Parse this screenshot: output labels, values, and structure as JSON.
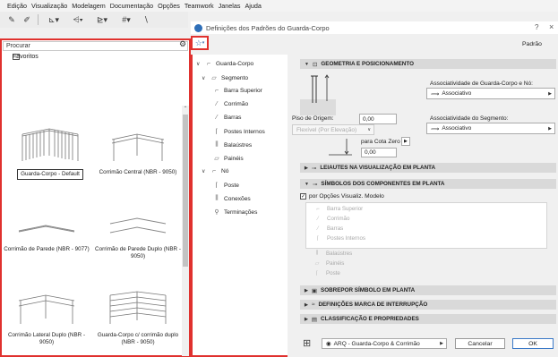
{
  "menubar": [
    "Edição",
    "Visualização",
    "Modelagem",
    "Documentação",
    "Opções",
    "Teamwork",
    "Janelas",
    "Ajuda"
  ],
  "library": {
    "search_placeholder": "Procurar",
    "favorites_label": "Favoritos",
    "items": [
      {
        "caption": "Guarda-Corpo - Default",
        "selected": true
      },
      {
        "caption": "Corrimão Central (NBR - 9050)",
        "selected": false
      },
      {
        "caption": "Corrimão de Parede (NBR - 9077)",
        "selected": false
      },
      {
        "caption": "Corrimão de Parede Duplo (NBR - 9050)",
        "selected": false
      },
      {
        "caption": "Corrimão Lateral Duplo (NBR - 9050)",
        "selected": false
      },
      {
        "caption": "Guarda-Corpo c/ corrimão duplo (NBR - 9050)",
        "selected": false
      }
    ]
  },
  "dialog": {
    "title": "Definições dos Padrões do Guarda-Corpo",
    "help": "?",
    "close": "×",
    "preset_label": "Padrão"
  },
  "tree": [
    {
      "label": "Guarda-Corpo",
      "level": 0,
      "chev": "∨",
      "icon": "⌐"
    },
    {
      "label": "Segmento",
      "level": 1,
      "chev": "∨",
      "icon": "▱"
    },
    {
      "label": "Barra Superior",
      "level": 2,
      "chev": "",
      "icon": "⌐"
    },
    {
      "label": "Corrimão",
      "level": 2,
      "chev": "",
      "icon": "⁄"
    },
    {
      "label": "Barras",
      "level": 2,
      "chev": "",
      "icon": "⁄"
    },
    {
      "label": "Postes Internos",
      "level": 2,
      "chev": "",
      "icon": "⌈"
    },
    {
      "label": "Balaústres",
      "level": 2,
      "chev": "",
      "icon": "⫼"
    },
    {
      "label": "Painéis",
      "level": 2,
      "chev": "",
      "icon": "▱"
    },
    {
      "label": "Nó",
      "level": 1,
      "chev": "∨",
      "icon": "⌐"
    },
    {
      "label": "Poste",
      "level": 2,
      "chev": "",
      "icon": "⌈"
    },
    {
      "label": "Conexões",
      "level": 2,
      "chev": "",
      "icon": "⫼"
    },
    {
      "label": "Terminações",
      "level": 2,
      "chev": "",
      "icon": "⚲"
    }
  ],
  "sections": {
    "geometry": "GEOMETRIA E POSICIONAMENTO",
    "layout": "LEIAUTES NA VISUALIZAÇÃO EM PLANTA",
    "symbols": "SÍMBOLOS DOS COMPONENTES EM PLANTA",
    "overlay": "SOBREPOR SÍMBOLO EM PLANTA",
    "break": "DEFINIÇÕES MARCA DE INTERRUPÇÃO",
    "classification": "CLASSIFICAÇÃO E PROPRIEDADES"
  },
  "geometry": {
    "height_value": "0,00",
    "assoc_node_label": "Associatividade de Guarda-Corpo e Nó:",
    "assoc_node_value": "Associativo",
    "origin_floor_label": "Piso de Origem:",
    "origin_floor_value": "Flexível (Por Elevação)",
    "to_zero_label": "para Cota Zero",
    "to_zero_value": "0,00",
    "assoc_segment_label": "Associatividade do Segmento:",
    "assoc_segment_value": "Associativo"
  },
  "symbols": {
    "by_model_label": "por Opções Visualiz. Modelo",
    "by_model_checked": true,
    "components": [
      "Barra Superior",
      "Corrimão",
      "Barras",
      "Postes Internos",
      "Balaústres",
      "Painéis",
      "Poste"
    ]
  },
  "bottom": {
    "layer_value": "ARQ - Guarda-Corpo & Corrimão",
    "cancel": "Cancelar",
    "ok": "OK"
  },
  "colors": {
    "highlight": "#e0312e",
    "accent": "#3b79c7"
  }
}
